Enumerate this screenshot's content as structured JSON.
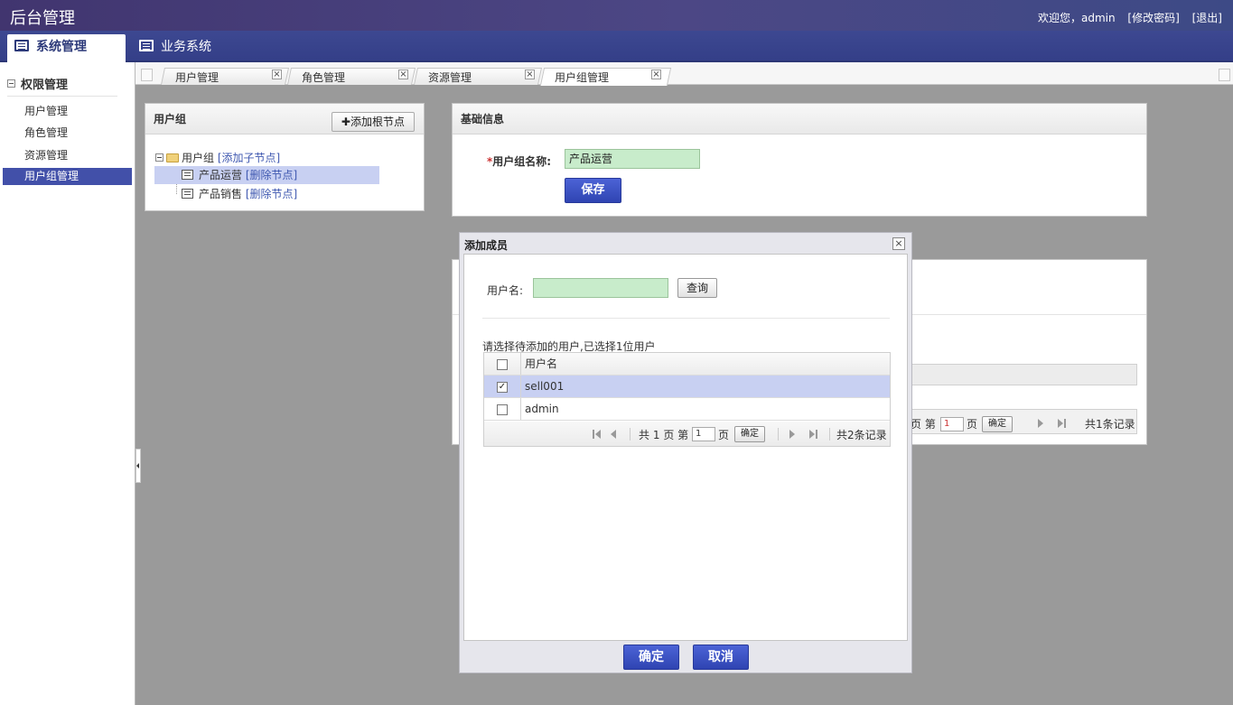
{
  "header": {
    "title": "后台管理",
    "welcome": "欢迎您，admin",
    "change_password": "[修改密码]",
    "logout": "[退出]"
  },
  "nav": {
    "tabs": [
      {
        "label": "系统管理",
        "active": true
      },
      {
        "label": "业务系统",
        "active": false
      }
    ]
  },
  "sidebar": {
    "section_title": "权限管理",
    "items": [
      {
        "label": "用户管理",
        "active": false
      },
      {
        "label": "角色管理",
        "active": false
      },
      {
        "label": "资源管理",
        "active": false
      },
      {
        "label": "用户组管理",
        "active": true
      }
    ]
  },
  "tabs": [
    {
      "label": "用户管理",
      "active": false
    },
    {
      "label": "角色管理",
      "active": false
    },
    {
      "label": "资源管理",
      "active": false
    },
    {
      "label": "用户组管理",
      "active": true
    }
  ],
  "tree_panel": {
    "title": "用户组",
    "add_root_button": "添加根节点",
    "root": {
      "label": "用户组",
      "action": "[添加子节点]"
    },
    "children": [
      {
        "label": "产品运营",
        "action": "[删除节点]",
        "selected": true
      },
      {
        "label": "产品销售",
        "action": "[删除节点]",
        "selected": false
      }
    ]
  },
  "basic_info": {
    "title": "基础信息",
    "name_label": "用户组名称:",
    "required_mark": "*",
    "name_value": "产品运营",
    "save_button": "保存"
  },
  "background_pager": {
    "page_prefix": "页 第",
    "page_value": "1",
    "page_suffix": "页",
    "go_button": "确定",
    "total": "共1条记录"
  },
  "dialog": {
    "title": "添加成员",
    "close_glyph": "×",
    "username_label": "用户名:",
    "search_button": "查询",
    "hint": "请选择待添加的用户,已选择1位用户",
    "grid": {
      "header": "用户名",
      "rows": [
        {
          "name": "sell001",
          "checked": true
        },
        {
          "name": "admin",
          "checked": false
        }
      ]
    },
    "pager": {
      "total_pages_prefix": "共",
      "total_pages": "1",
      "total_pages_suffix": "页 第",
      "page_value": "1",
      "page_suffix": "页",
      "go_button": "确定",
      "total_records": "共2条记录"
    },
    "ok_button": "确定",
    "cancel_button": "取消"
  },
  "colors": {
    "header_bg": "#41356f",
    "nav_bg": "#3d4891",
    "sidebar_active": "#4250a9",
    "primary_button": "#3a50c4",
    "field_bg": "#c8eccb",
    "selected_row": "#c8d0f2",
    "link": "#3f58b0"
  }
}
